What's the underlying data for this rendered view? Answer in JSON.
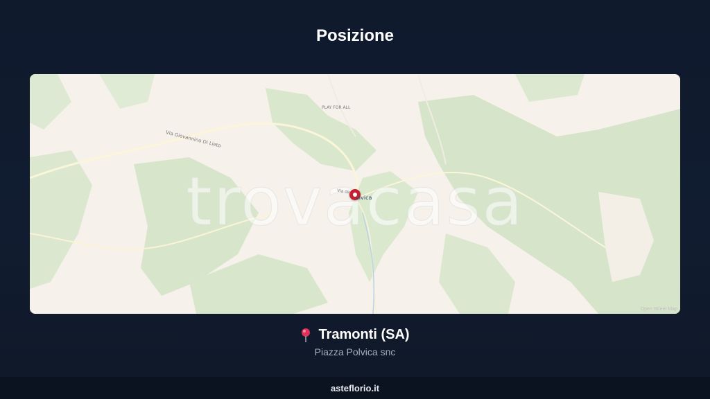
{
  "header": {
    "title": "Posizione"
  },
  "map": {
    "watermark": "trovacasa",
    "place_label": "olvica",
    "street_label_1": "Via Giovannino Di Lieto",
    "street_label_2": "PLAY FOR ALL",
    "street_label_3": "Via de",
    "attribution": "Open Street Map",
    "pin_color": "#c71f30"
  },
  "location": {
    "name": "Tramonti (SA)",
    "address": "Piazza Polvica snc",
    "pin_icon": "map-pin-icon"
  },
  "footer": {
    "site": "asteflorio.it"
  }
}
